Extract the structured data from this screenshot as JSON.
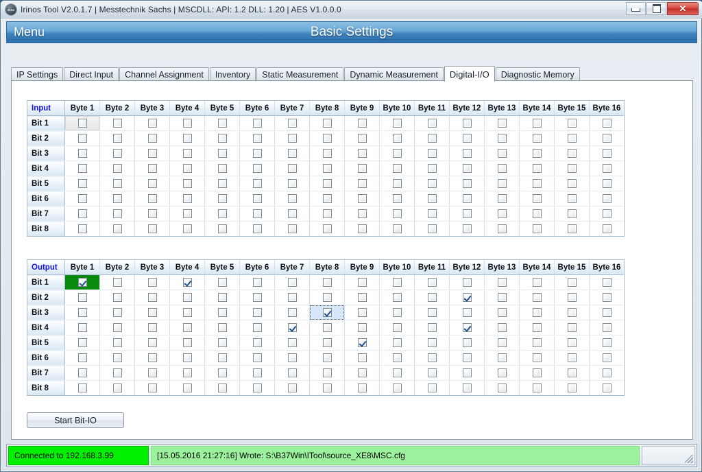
{
  "window": {
    "title": "Irinos Tool V2.0.1.7 | Messtechnik Sachs | MSCDLL: API: 1.2 DLL: 1.20 | AES V1.0.0.0",
    "app_icon": "app-logo-icon",
    "controls": {
      "minimize": "minimize-icon",
      "maximize": "maximize-icon",
      "close_label": "✕"
    }
  },
  "banner": {
    "menu_label": "Menu",
    "title": "Basic Settings",
    "accent_color": "#3e83bd"
  },
  "tabs": [
    {
      "label": "IP Settings",
      "active": false
    },
    {
      "label": "Direct Input",
      "active": false
    },
    {
      "label": "Channel Assignment",
      "active": false
    },
    {
      "label": "Inventory",
      "active": false
    },
    {
      "label": "Static Measurement",
      "active": false
    },
    {
      "label": "Dynamic Measurement",
      "active": false
    },
    {
      "label": "Digital-I/O",
      "active": true
    },
    {
      "label": "Diagnostic Memory",
      "active": false
    }
  ],
  "columns": [
    "Byte 1",
    "Byte 2",
    "Byte 3",
    "Byte 4",
    "Byte 5",
    "Byte 6",
    "Byte 7",
    "Byte 8",
    "Byte 9",
    "Byte 10",
    "Byte 11",
    "Byte 12",
    "Byte 13",
    "Byte 14",
    "Byte 15",
    "Byte 16"
  ],
  "rows": [
    "Bit 1",
    "Bit 2",
    "Bit 3",
    "Bit 4",
    "Bit 5",
    "Bit 6",
    "Bit 7",
    "Bit 8"
  ],
  "input_grid": {
    "corner_label": "Input",
    "corner_color": "#1414e0",
    "checked": [],
    "selected_cell": {
      "row": 0,
      "col": 0,
      "style": "sel-gray"
    }
  },
  "output_grid": {
    "corner_label": "Output",
    "corner_color": "#1414e0",
    "checked": [
      {
        "row": 0,
        "col": 0
      },
      {
        "row": 0,
        "col": 3
      },
      {
        "row": 1,
        "col": 11
      },
      {
        "row": 2,
        "col": 7
      },
      {
        "row": 3,
        "col": 6
      },
      {
        "row": 3,
        "col": 11
      },
      {
        "row": 4,
        "col": 8
      }
    ],
    "highlighted": [
      {
        "row": 0,
        "col": 0,
        "style": "sel-green",
        "color": "#0a8a0a"
      },
      {
        "row": 2,
        "col": 7,
        "style": "sel-blue",
        "color": "#d6e7fa"
      }
    ]
  },
  "start_button": {
    "label": "Start Bit-IO"
  },
  "statusbar": {
    "connection": "Connected to 192.168.3.99",
    "connection_color": "#00f000",
    "message": "[15.05.2016 21:27:16] Wrote: S:\\B37Win\\ITool\\source_XE8\\MSC.cfg",
    "message_color": "#9cf29c",
    "grip": "resize-grip-icon"
  }
}
